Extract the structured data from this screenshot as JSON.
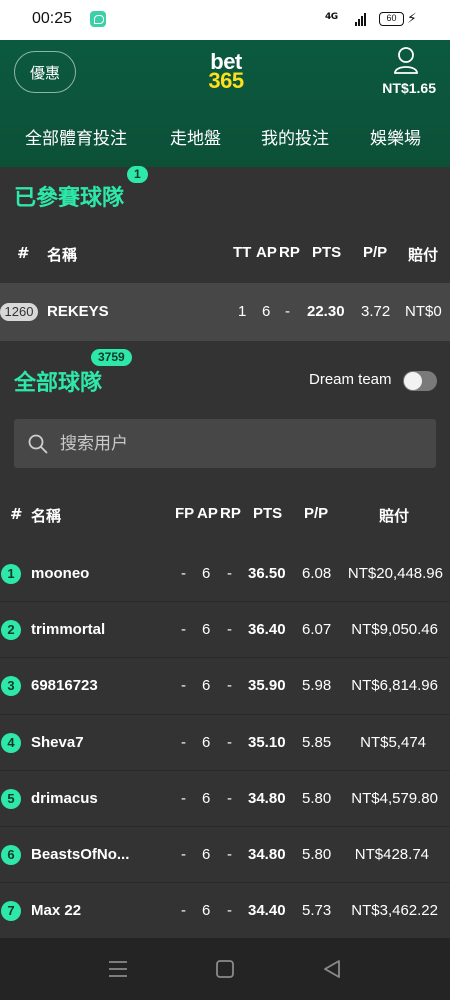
{
  "status_bar": {
    "time": "00:25",
    "network": "4G",
    "battery": "60"
  },
  "header": {
    "promo_label": "優惠",
    "logo_top": "bet",
    "logo_bottom": "365",
    "balance": "NT$1.65",
    "nav": [
      "全部體育投注",
      "走地盤",
      "我的投注",
      "娛樂場"
    ]
  },
  "entered": {
    "title": "已參賽球隊",
    "badge": "1",
    "columns": {
      "rank": "#",
      "name": "名稱",
      "tt": "TT",
      "ap": "AP",
      "rp": "RP",
      "pts": "PTS",
      "pp": "P/P",
      "payout": "賠付"
    },
    "row": {
      "rank": "1260",
      "name": "REKEYS",
      "tt": "1",
      "ap": "6",
      "rp": "-",
      "pts": "22.30",
      "pp": "3.72",
      "payout": "NT$0"
    }
  },
  "all_teams": {
    "title": "全部球隊",
    "badge": "3759",
    "dream_team_label": "Dream team",
    "search_placeholder": "搜索用户",
    "columns": {
      "rank": "#",
      "name": "名稱",
      "fp": "FP",
      "ap": "AP",
      "rp": "RP",
      "pts": "PTS",
      "pp": "P/P",
      "payout": "賠付"
    },
    "rows": [
      {
        "rank": "1",
        "name": "mooneo",
        "fp": "-",
        "ap": "6",
        "rp": "-",
        "pts": "36.50",
        "pp": "6.08",
        "payout": "NT$20,448.96"
      },
      {
        "rank": "2",
        "name": "trimmortal",
        "fp": "-",
        "ap": "6",
        "rp": "-",
        "pts": "36.40",
        "pp": "6.07",
        "payout": "NT$9,050.46"
      },
      {
        "rank": "3",
        "name": "69816723",
        "fp": "-",
        "ap": "6",
        "rp": "-",
        "pts": "35.90",
        "pp": "5.98",
        "payout": "NT$6,814.96"
      },
      {
        "rank": "4",
        "name": "Sheva7",
        "fp": "-",
        "ap": "6",
        "rp": "-",
        "pts": "35.10",
        "pp": "5.85",
        "payout": "NT$5,474"
      },
      {
        "rank": "5",
        "name": "drimacus",
        "fp": "-",
        "ap": "6",
        "rp": "-",
        "pts": "34.80",
        "pp": "5.80",
        "payout": "NT$4,579.80"
      },
      {
        "rank": "6",
        "name": "BeastsOfNo...",
        "fp": "-",
        "ap": "6",
        "rp": "-",
        "pts": "34.80",
        "pp": "5.80",
        "payout": "NT$428.74"
      },
      {
        "rank": "7",
        "name": "Max 22",
        "fp": "-",
        "ap": "6",
        "rp": "-",
        "pts": "34.40",
        "pp": "5.73",
        "payout": "NT$3,462.22"
      }
    ]
  },
  "colors": {
    "header_green": "#0b5a40",
    "accent_green": "#2ee8a9",
    "logo_yellow": "#ffdf1b",
    "background": "#333333"
  }
}
